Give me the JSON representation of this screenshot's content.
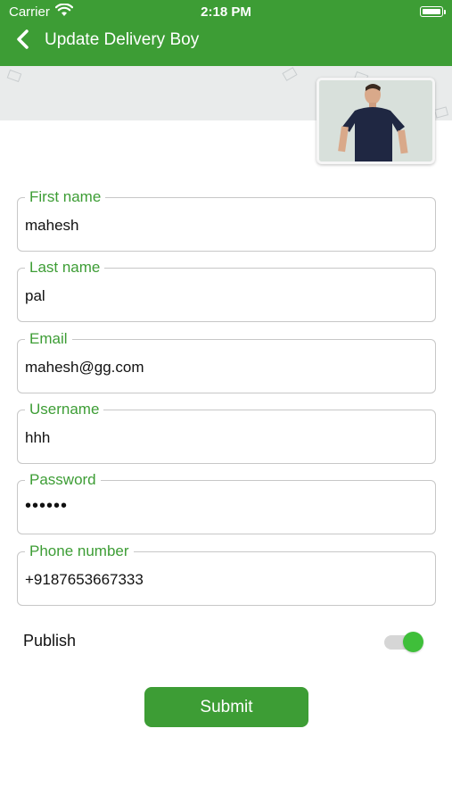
{
  "status_bar": {
    "carrier": "Carrier",
    "time": "2:18 PM",
    "wifi_icon": "wifi-icon",
    "battery_icon": "battery-icon"
  },
  "header": {
    "title": "Update Delivery Boy",
    "back_icon": "chevron-left-icon",
    "background_color": "#3d9d35"
  },
  "profile": {
    "avatar": "profile-photo"
  },
  "form": {
    "fields": [
      {
        "label": "First name",
        "value": "mahesh"
      },
      {
        "label": "Last name",
        "value": "pal"
      },
      {
        "label": "Email",
        "value": "mahesh@gg.com"
      },
      {
        "label": "Username",
        "value": "hhh"
      },
      {
        "label": "Password",
        "value": "••••••"
      },
      {
        "label": "Phone number",
        "value": "+9187653667333"
      }
    ],
    "publish_label": "Publish",
    "publish_enabled": true,
    "submit_label": "Submit"
  },
  "colors": {
    "accent": "#3d9d35",
    "toggle_on": "#3fbf3a",
    "field_border": "#c7c7c7"
  }
}
